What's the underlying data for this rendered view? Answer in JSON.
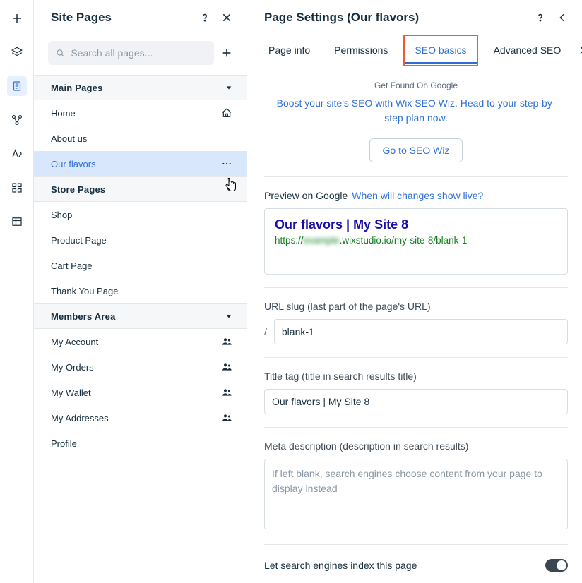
{
  "pagesPanel": {
    "title": "Site Pages",
    "search": {
      "placeholder": "Search all pages..."
    },
    "sections": [
      {
        "label": "Main Pages",
        "items": [
          {
            "label": "Home",
            "iconRight": "home"
          },
          {
            "label": "About us"
          },
          {
            "label": "Our flavors",
            "active": true,
            "iconRight": "more"
          }
        ]
      },
      {
        "label": "Store Pages",
        "items": [
          {
            "label": "Shop"
          },
          {
            "label": "Product Page"
          },
          {
            "label": "Cart Page"
          },
          {
            "label": "Thank You Page"
          }
        ]
      },
      {
        "label": "Members Area",
        "items": [
          {
            "label": "My Account",
            "iconRight": "members"
          },
          {
            "label": "My Orders",
            "iconRight": "members"
          },
          {
            "label": "My Wallet",
            "iconRight": "members"
          },
          {
            "label": "My Addresses",
            "iconRight": "members"
          },
          {
            "label": "Profile"
          }
        ]
      }
    ]
  },
  "settingsPanel": {
    "title": "Page Settings (Our flavors)",
    "tabs": [
      "Page info",
      "Permissions",
      "SEO basics",
      "Advanced SEO"
    ],
    "activeTab": "SEO basics",
    "promo": {
      "heading": "Get Found On Google",
      "body": "Boost your site's SEO with Wix SEO Wiz. Head to your step-by-step plan now.",
      "button": "Go to SEO Wiz"
    },
    "preview": {
      "label": "Preview on Google",
      "linkText": "When will changes show live?",
      "serpTitle": "Our flavors | My Site 8",
      "serpUrlPrefix": "https://",
      "serpUrlBlur": "example",
      "serpUrlSuffix": ".wixstudio.io/my-site-8/blank-1"
    },
    "fields": {
      "slugLabel": "URL slug (last part of the page's URL)",
      "slugValue": "blank-1",
      "titleLabel": "Title tag (title in search results title)",
      "titleValue": "Our flavors | My Site 8",
      "metaLabel": "Meta description (description in search results)",
      "metaPlaceholder": "If left blank, search engines choose content from your page to display instead",
      "indexLabel": "Let search engines index this page",
      "indexValue": true
    }
  }
}
